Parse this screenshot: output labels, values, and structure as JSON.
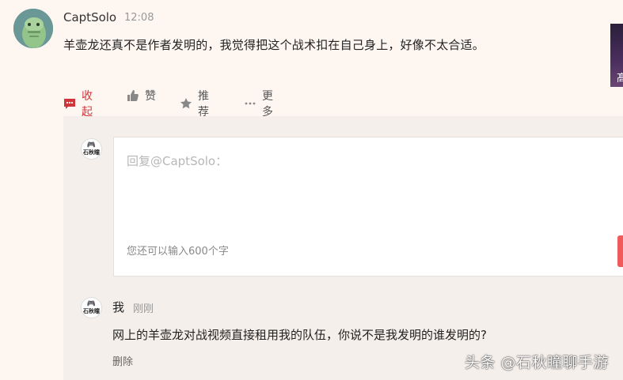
{
  "comment": {
    "username": "CaptSolo",
    "time": "12:08",
    "text": "羊壶龙还真不是作者发明的，我觉得把这个战术扣在自己身上，好像不太合适。"
  },
  "side_thumb_text": "髙",
  "actions": {
    "collapse": "收起",
    "like": "赞",
    "recommend": "推荐",
    "more": "更多"
  },
  "reply_box": {
    "avatar_text": "石秋瞳",
    "placeholder": "回复@CaptSolo：",
    "char_hint": "您还可以输入600个字"
  },
  "reply": {
    "avatar_text": "石秋瞳",
    "username": "我",
    "time": "刚刚",
    "text": "网上的羊壶龙对战视频直接租用我的队伍，你说不是我发明的谁发明的?",
    "delete_label": "删除"
  },
  "watermark": "头条 @石秋瞳聊手游",
  "colors": {
    "background": "#fdf6f1",
    "panel": "#f5efeb",
    "accent_red": "#d0353a",
    "submit_red": "#f05a5a"
  }
}
